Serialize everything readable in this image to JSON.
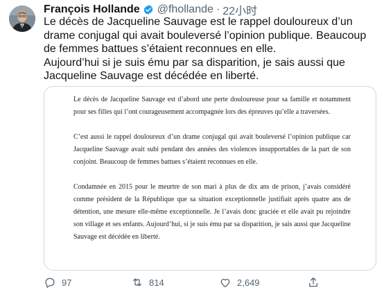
{
  "tweet": {
    "author_name": "François Hollande",
    "handle": "@fhollande",
    "time": "22小时",
    "text_paragraphs": [
      "Le décès de Jacqueline Sauvage est le rappel douloureux d’un drame conjugal qui avait bouleversé l’opinion publique. Beaucoup de femmes battues s’étaient reconnues en elle.",
      "Aujourd’hui si je suis ému par sa disparition, je sais aussi que Jacqueline Sauvage est décédée en liberté."
    ]
  },
  "statement": {
    "paragraphs": [
      "Le décès de Jacqueline Sauvage est d’abord une perte douloureuse pour sa famille et notamment pour ses filles qui l’ont courageusement accompagnée lors des épreuves qu’elle a traversées.",
      "C’est aussi le rappel douloureux d’un drame conjugal qui avait bouleversé l’opinion publique car Jacqueline Sauvage avait subi pendant des années des violences insupportables de la part de son conjoint. Beaucoup de femmes battues s’étaient reconnues en elle.",
      "Condamnée en 2015 pour le meurtre de son mari à plus de dix ans de prison, j’avais considéré comme président de la République que sa situation exceptionnelle justifiait après quatre ans de détention, une mesure elle-même exceptionnelle. Je l’avais donc graciée et elle avait pu rejoindre son village et ses enfants. Aujourd’hui, si je suis ému par sa disparition, je sais aussi que Jacqueline Sauvage est décédée en liberté."
    ]
  },
  "actions": {
    "replies": "97",
    "retweets": "814",
    "likes": "2,649"
  },
  "icons": {
    "verified": "verified-badge-icon",
    "reply": "reply-icon",
    "retweet": "retweet-icon",
    "like": "heart-icon",
    "share": "share-icon"
  },
  "colors": {
    "verified": "#1d9bf0",
    "secondary_text": "#536471",
    "card_border": "#cfd9de"
  }
}
